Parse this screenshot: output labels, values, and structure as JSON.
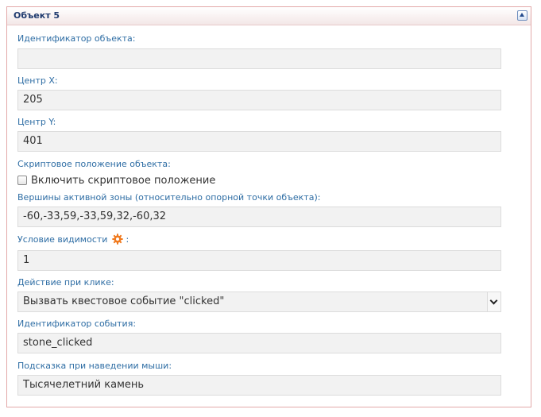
{
  "panel": {
    "title": "Объект 5"
  },
  "fields": {
    "object_id": {
      "label": "Идентификатор объекта:",
      "value": ""
    },
    "center_x": {
      "label": "Центр X:",
      "value": "205"
    },
    "center_y": {
      "label": "Центр Y:",
      "value": "401"
    },
    "script_position": {
      "label": "Скриптовое положение объекта:",
      "checkbox_label": "Включить скриптовое положение",
      "checked": false
    },
    "active_zone": {
      "label": "Вершины активной зоны (относительно опорной точки объекта):",
      "value": "-60,-33,59,-33,59,32,-60,32"
    },
    "visibility": {
      "label": "Условие видимости",
      "label_suffix": ":",
      "value": "1"
    },
    "click_action": {
      "label": "Действие при клике:",
      "selected": "Вызвать квестовое событие \"clicked\""
    },
    "event_id": {
      "label": "Идентификатор события:",
      "value": "stone_clicked"
    },
    "hover_hint": {
      "label": "Подсказка при наведении мыши:",
      "value": "Тысячелетний камень"
    }
  },
  "icons": {
    "collapse": "collapse-up-icon",
    "visibility_settings": "gear-icon"
  },
  "colors": {
    "panel_border": "#e3a9a9",
    "title": "#1f3a6e",
    "label": "#2e6da4",
    "field_bg": "#f2f2f2",
    "gear": "#f07a1f"
  }
}
